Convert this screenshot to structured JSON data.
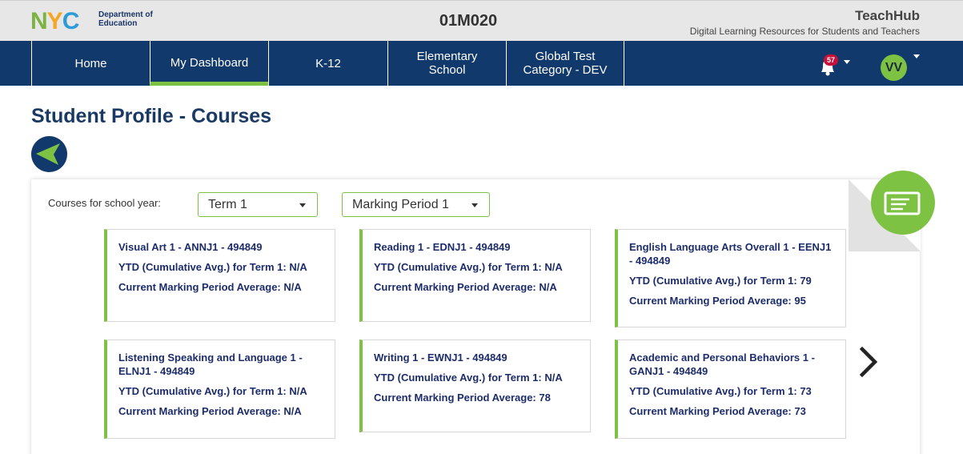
{
  "header": {
    "logo_nyc": [
      "N",
      "Y",
      "C"
    ],
    "logo_dept_line1": "Department of",
    "logo_dept_line2": "Education",
    "school_code": "01M020",
    "brand_title": "TeachHub",
    "brand_subtitle": "Digital Learning Resources for Students and Teachers"
  },
  "nav": {
    "items": [
      {
        "label": "Home"
      },
      {
        "label": "My Dashboard",
        "active": true
      },
      {
        "label": "K-12"
      },
      {
        "label": "Elementary School"
      },
      {
        "label": "Global Test Category - DEV"
      }
    ],
    "notification_count": "57",
    "avatar_initials": "VV"
  },
  "page": {
    "title": "Student Profile - Courses"
  },
  "filters": {
    "label": "Courses for school year:",
    "term": "Term 1",
    "marking_period": "Marking Period 1"
  },
  "courses": [
    {
      "title": "Visual Art 1 - ANNJ1 - 494849",
      "ytd": "YTD (Cumulative Avg.) for Term 1: N/A",
      "current": "Current Marking Period Average: N/A"
    },
    {
      "title": "Reading 1 - EDNJ1 - 494849",
      "ytd": "YTD (Cumulative Avg.) for Term 1: N/A",
      "current": "Current Marking Period Average: N/A"
    },
    {
      "title": "English Language Arts Overall 1 - EENJ1 - 494849",
      "ytd": "YTD (Cumulative Avg.) for Term 1: 79",
      "current": "Current Marking Period Average: 95"
    },
    {
      "title": "Listening Speaking and Language 1 - ELNJ1 - 494849",
      "ytd": "YTD (Cumulative Avg.) for Term 1: N/A",
      "current": "Current Marking Period Average: N/A"
    },
    {
      "title": "Writing 1 - EWNJ1 - 494849",
      "ytd": "YTD (Cumulative Avg.) for Term 1: N/A",
      "current": "Current Marking Period Average: 78"
    },
    {
      "title": "Academic and Personal Behaviors 1 - GANJ1 - 494849",
      "ytd": "YTD (Cumulative Avg.) for Term 1: 73",
      "current": "Current Marking Period Average: 73"
    }
  ],
  "colors": {
    "nav_bg": "#11396b",
    "accent_green": "#7dc243",
    "title_blue": "#1a3a66",
    "card_text": "#1d2d6b",
    "badge_red": "#c8103c"
  },
  "icons": {
    "back": "back-arrow-icon",
    "board": "whiteboard-icon",
    "bell": "bell-icon",
    "next": "chevron-right-icon"
  }
}
